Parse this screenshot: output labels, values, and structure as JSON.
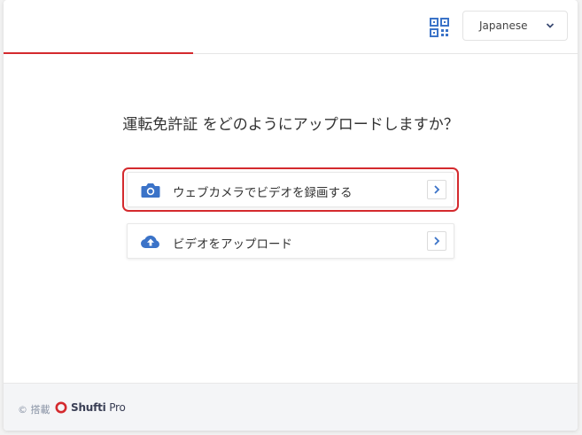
{
  "header": {
    "progress_percent": 33,
    "qr_icon": "qr-code-icon",
    "language": {
      "selected": "Japanese",
      "icon": "chevron-down-icon"
    }
  },
  "main": {
    "question": "運転免許証 をどのようにアップロードしますか？",
    "options": [
      {
        "label": "ウェブカメラでビデオを録画する",
        "icon": "camera-icon",
        "arrow_icon": "chevron-right-icon",
        "highlighted": true
      },
      {
        "label": "ビデオをアップロード",
        "icon": "cloud-upload-icon",
        "arrow_icon": "chevron-right-icon",
        "highlighted": false
      }
    ]
  },
  "footer": {
    "powered_by": "© 搭載",
    "brand_bold": "Shufti",
    "brand_light": " Pro",
    "logo_icon": "shufti-pro-logo-icon"
  },
  "colors": {
    "accent": "#d42a2e",
    "icon_blue": "#3b73c8",
    "text": "#333333",
    "muted": "#8a94a6"
  }
}
